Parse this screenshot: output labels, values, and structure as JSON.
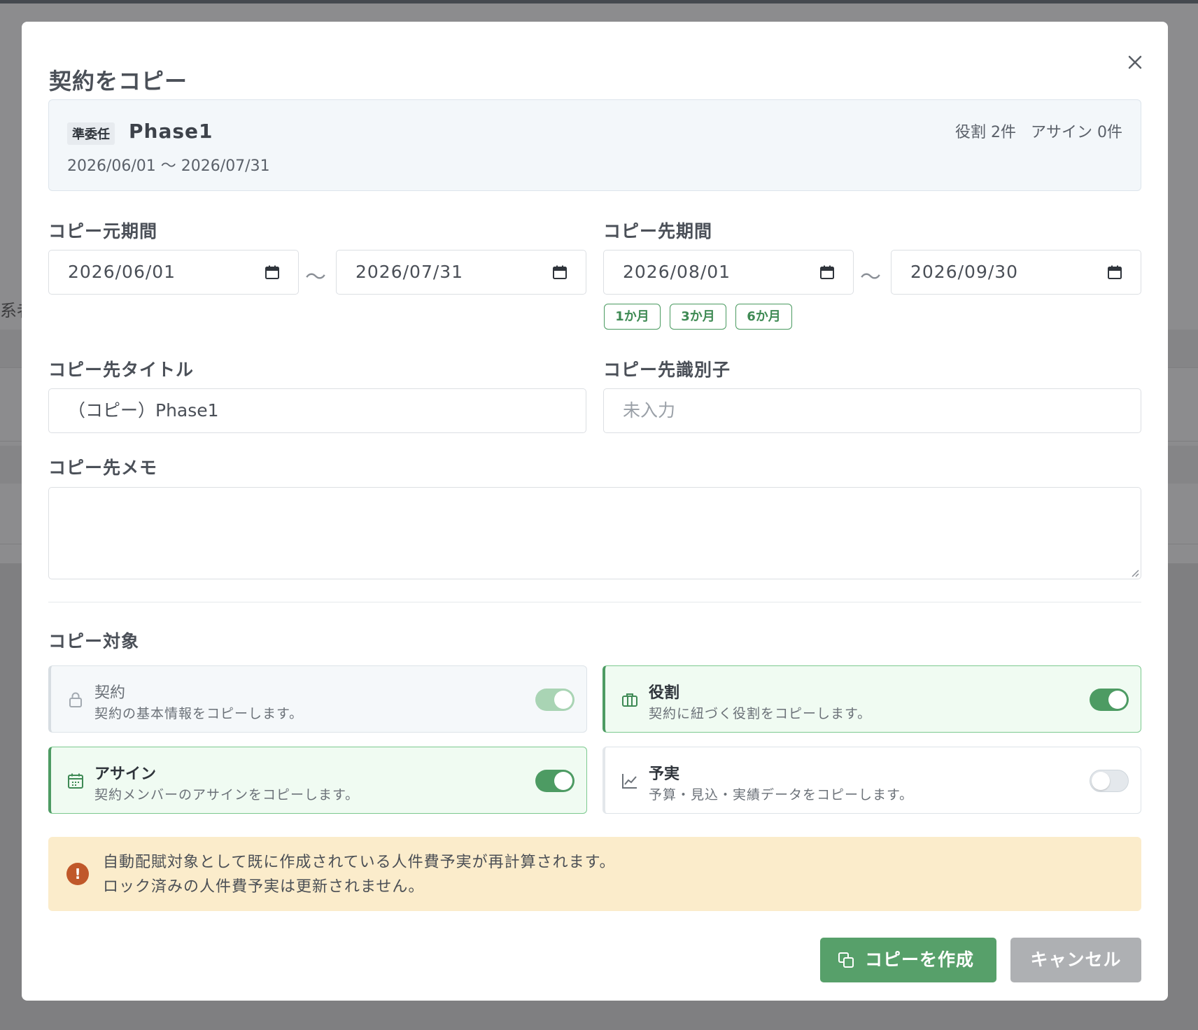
{
  "background": {
    "partial_label": "系者"
  },
  "modal": {
    "title": "契約をコピー",
    "close_icon": "close-icon"
  },
  "summary": {
    "badge": "準委任",
    "title": "Phase1",
    "period": "2026/06/01 〜 2026/07/31",
    "roles_count": "役割 2件",
    "assign_count": "アサイン 0件"
  },
  "source_period": {
    "label": "コピー元期間",
    "start": "2026/06/01",
    "end": "2026/07/31",
    "separator": "〜"
  },
  "target_period": {
    "label": "コピー先期間",
    "start": "2026/08/01",
    "end": "2026/09/30",
    "separator": "〜",
    "presets": [
      "1か月",
      "3か月",
      "6か月"
    ]
  },
  "target_title": {
    "label": "コピー先タイトル",
    "value": "（コピー）Phase1"
  },
  "target_identifier": {
    "label": "コピー先識別子",
    "placeholder": "未入力"
  },
  "target_memo": {
    "label": "コピー先メモ",
    "value": ""
  },
  "copy_targets": {
    "label": "コピー対象",
    "items": [
      {
        "title": "契約",
        "description": "契約の基本情報をコピーします。",
        "icon": "lock-icon",
        "state": "on-disabled"
      },
      {
        "title": "役割",
        "description": "契約に紐づく役割をコピーします。",
        "icon": "briefcase-icon",
        "state": "on"
      },
      {
        "title": "アサイン",
        "description": "契約メンバーのアサインをコピーします。",
        "icon": "calendar-icon",
        "state": "on"
      },
      {
        "title": "予実",
        "description": "予算・見込・実績データをコピーします。",
        "icon": "chart-icon",
        "state": "off"
      }
    ]
  },
  "alert": {
    "icon": "!",
    "line1": "自動配賦対象として既に作成されている人件費予実が再計算されます。",
    "line2": "ロック済みの人件費予実は更新されません。"
  },
  "buttons": {
    "create": "コピーを作成",
    "cancel": "キャンセル"
  },
  "colors": {
    "accent": "#57a06a",
    "warning_bg": "#fbeccb",
    "warning_icon": "#c0582a"
  }
}
